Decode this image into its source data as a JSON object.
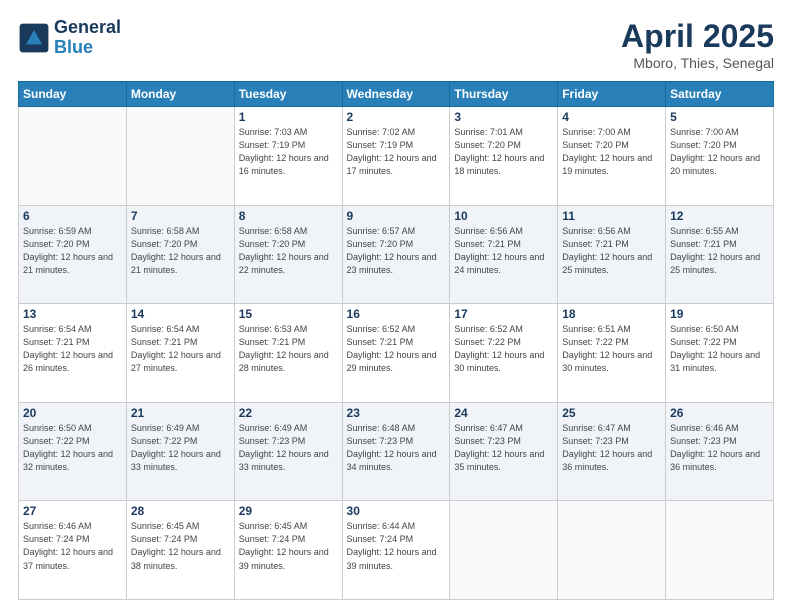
{
  "header": {
    "logo_line1": "General",
    "logo_line2": "Blue",
    "title": "April 2025",
    "subtitle": "Mboro, Thies, Senegal"
  },
  "weekdays": [
    "Sunday",
    "Monday",
    "Tuesday",
    "Wednesday",
    "Thursday",
    "Friday",
    "Saturday"
  ],
  "weeks": [
    [
      {
        "day": null
      },
      {
        "day": null
      },
      {
        "day": "1",
        "sunrise": "7:03 AM",
        "sunset": "7:19 PM",
        "daylight": "12 hours and 16 minutes."
      },
      {
        "day": "2",
        "sunrise": "7:02 AM",
        "sunset": "7:19 PM",
        "daylight": "12 hours and 17 minutes."
      },
      {
        "day": "3",
        "sunrise": "7:01 AM",
        "sunset": "7:20 PM",
        "daylight": "12 hours and 18 minutes."
      },
      {
        "day": "4",
        "sunrise": "7:00 AM",
        "sunset": "7:20 PM",
        "daylight": "12 hours and 19 minutes."
      },
      {
        "day": "5",
        "sunrise": "7:00 AM",
        "sunset": "7:20 PM",
        "daylight": "12 hours and 20 minutes."
      }
    ],
    [
      {
        "day": "6",
        "sunrise": "6:59 AM",
        "sunset": "7:20 PM",
        "daylight": "12 hours and 21 minutes."
      },
      {
        "day": "7",
        "sunrise": "6:58 AM",
        "sunset": "7:20 PM",
        "daylight": "12 hours and 21 minutes."
      },
      {
        "day": "8",
        "sunrise": "6:58 AM",
        "sunset": "7:20 PM",
        "daylight": "12 hours and 22 minutes."
      },
      {
        "day": "9",
        "sunrise": "6:57 AM",
        "sunset": "7:20 PM",
        "daylight": "12 hours and 23 minutes."
      },
      {
        "day": "10",
        "sunrise": "6:56 AM",
        "sunset": "7:21 PM",
        "daylight": "12 hours and 24 minutes."
      },
      {
        "day": "11",
        "sunrise": "6:56 AM",
        "sunset": "7:21 PM",
        "daylight": "12 hours and 25 minutes."
      },
      {
        "day": "12",
        "sunrise": "6:55 AM",
        "sunset": "7:21 PM",
        "daylight": "12 hours and 25 minutes."
      }
    ],
    [
      {
        "day": "13",
        "sunrise": "6:54 AM",
        "sunset": "7:21 PM",
        "daylight": "12 hours and 26 minutes."
      },
      {
        "day": "14",
        "sunrise": "6:54 AM",
        "sunset": "7:21 PM",
        "daylight": "12 hours and 27 minutes."
      },
      {
        "day": "15",
        "sunrise": "6:53 AM",
        "sunset": "7:21 PM",
        "daylight": "12 hours and 28 minutes."
      },
      {
        "day": "16",
        "sunrise": "6:52 AM",
        "sunset": "7:21 PM",
        "daylight": "12 hours and 29 minutes."
      },
      {
        "day": "17",
        "sunrise": "6:52 AM",
        "sunset": "7:22 PM",
        "daylight": "12 hours and 30 minutes."
      },
      {
        "day": "18",
        "sunrise": "6:51 AM",
        "sunset": "7:22 PM",
        "daylight": "12 hours and 30 minutes."
      },
      {
        "day": "19",
        "sunrise": "6:50 AM",
        "sunset": "7:22 PM",
        "daylight": "12 hours and 31 minutes."
      }
    ],
    [
      {
        "day": "20",
        "sunrise": "6:50 AM",
        "sunset": "7:22 PM",
        "daylight": "12 hours and 32 minutes."
      },
      {
        "day": "21",
        "sunrise": "6:49 AM",
        "sunset": "7:22 PM",
        "daylight": "12 hours and 33 minutes."
      },
      {
        "day": "22",
        "sunrise": "6:49 AM",
        "sunset": "7:23 PM",
        "daylight": "12 hours and 33 minutes."
      },
      {
        "day": "23",
        "sunrise": "6:48 AM",
        "sunset": "7:23 PM",
        "daylight": "12 hours and 34 minutes."
      },
      {
        "day": "24",
        "sunrise": "6:47 AM",
        "sunset": "7:23 PM",
        "daylight": "12 hours and 35 minutes."
      },
      {
        "day": "25",
        "sunrise": "6:47 AM",
        "sunset": "7:23 PM",
        "daylight": "12 hours and 36 minutes."
      },
      {
        "day": "26",
        "sunrise": "6:46 AM",
        "sunset": "7:23 PM",
        "daylight": "12 hours and 36 minutes."
      }
    ],
    [
      {
        "day": "27",
        "sunrise": "6:46 AM",
        "sunset": "7:24 PM",
        "daylight": "12 hours and 37 minutes."
      },
      {
        "day": "28",
        "sunrise": "6:45 AM",
        "sunset": "7:24 PM",
        "daylight": "12 hours and 38 minutes."
      },
      {
        "day": "29",
        "sunrise": "6:45 AM",
        "sunset": "7:24 PM",
        "daylight": "12 hours and 39 minutes."
      },
      {
        "day": "30",
        "sunrise": "6:44 AM",
        "sunset": "7:24 PM",
        "daylight": "12 hours and 39 minutes."
      },
      {
        "day": null
      },
      {
        "day": null
      },
      {
        "day": null
      }
    ]
  ]
}
